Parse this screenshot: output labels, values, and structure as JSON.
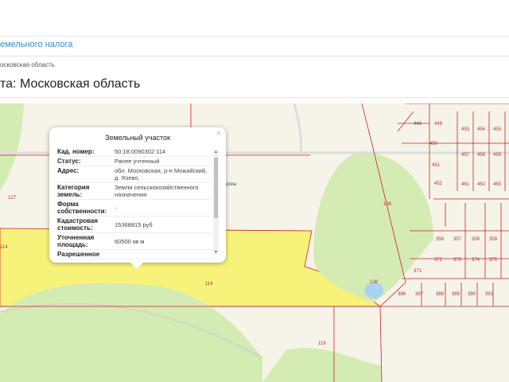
{
  "header": {
    "link": "емельного налога",
    "breadcrumb": "осковская область",
    "title": "та: Московская область"
  },
  "popup": {
    "title": "Земельный участок",
    "close": "×",
    "rows": [
      {
        "k": "Кад. номер:",
        "v": "50:18:0090302:114"
      },
      {
        "k": "Статус:",
        "v": "Ранее учтенный"
      },
      {
        "k": "Адрес:",
        "v": "обл. Московская, р-н Можайский, д. Язево,"
      },
      {
        "k": "Категория земель:",
        "v": "Земли сельскохозяйственного назначения"
      },
      {
        "k": "Форма собственности:",
        "v": "-"
      },
      {
        "k": "Кадастровая стоимость:",
        "v": "15368815 руб"
      },
      {
        "k": "Уточненная площадь:",
        "v": "60500 кв м"
      },
      {
        "k": "Разрешенное",
        "v": ""
      }
    ]
  },
  "map": {
    "labels": [
      "127",
      "114",
      "114",
      "136",
      "136",
      "119",
      "448",
      "449",
      "450",
      "451",
      "452",
      "453",
      "454",
      "455",
      "457",
      "458",
      "459",
      "461",
      "462",
      "463",
      "356",
      "357",
      "358",
      "359",
      "372",
      "373",
      "374",
      "375",
      "371",
      "386",
      "387",
      "388",
      "389",
      "390",
      "391",
      "ферма"
    ]
  },
  "colors": {
    "parcel": "#f7f27a",
    "forest": "#d4ebb4",
    "border": "#c8242b",
    "link": "#2a8dd4"
  }
}
